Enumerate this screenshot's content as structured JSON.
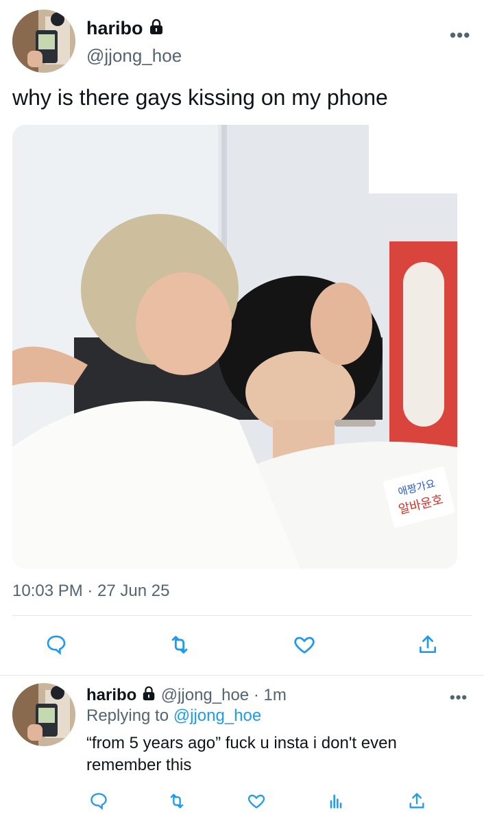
{
  "main_tweet": {
    "display_name": "haribo",
    "handle": "@jjong_hoe",
    "text": "why is there gays kissing on my phone",
    "timestamp": "10:03 PM · 27 Jun 25",
    "more_label": "•••",
    "protected": true
  },
  "media": {
    "sign_text": [
      "애짱가요",
      "알바윤호"
    ]
  },
  "reply_tweet": {
    "display_name": "haribo",
    "handle": "@jjong_hoe",
    "time_ago": "· 1m",
    "replying_label": "Replying to",
    "replying_handle": "@jjong_hoe",
    "text": "“from 5 years ago” fuck u insta i don't even remember this",
    "more_label": "•••"
  },
  "icons": {
    "reply": "reply-icon",
    "retweet": "retweet-icon",
    "like": "heart-icon",
    "share": "share-icon",
    "analytics": "analytics-icon",
    "lock": "lock-icon"
  },
  "colors": {
    "accent": "#1d9bf0",
    "secondary_text": "#536471",
    "text": "#0f1419"
  }
}
